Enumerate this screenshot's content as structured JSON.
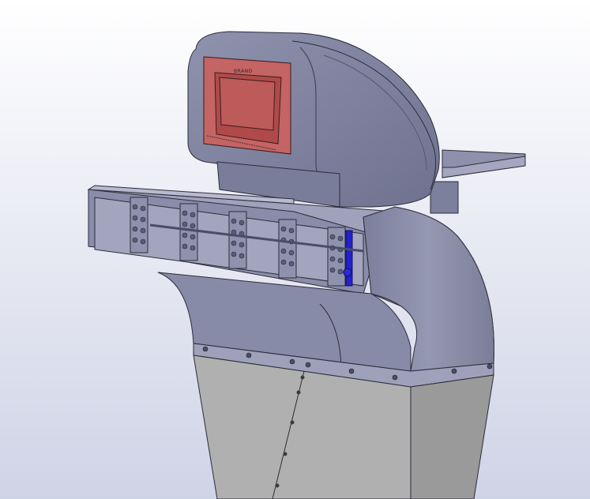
{
  "scene": {
    "description_free": true,
    "colors": {
      "background_top": "#ffffff",
      "background_bottom": "#cfd3e6",
      "body_metal": "#8b8ea8",
      "body_metal_dark": "#6e7190",
      "body_metal_light": "#a9abc2",
      "lower_base": "#b3b3b3",
      "lower_base_dark": "#8e8e8e",
      "screen_bezel": "#c46464",
      "screen_glass": "#b04a4a",
      "accent_blue": "#2222cc",
      "edge": "#2c2c3a"
    }
  },
  "display_panel": {
    "logo_text": "BRAND"
  }
}
